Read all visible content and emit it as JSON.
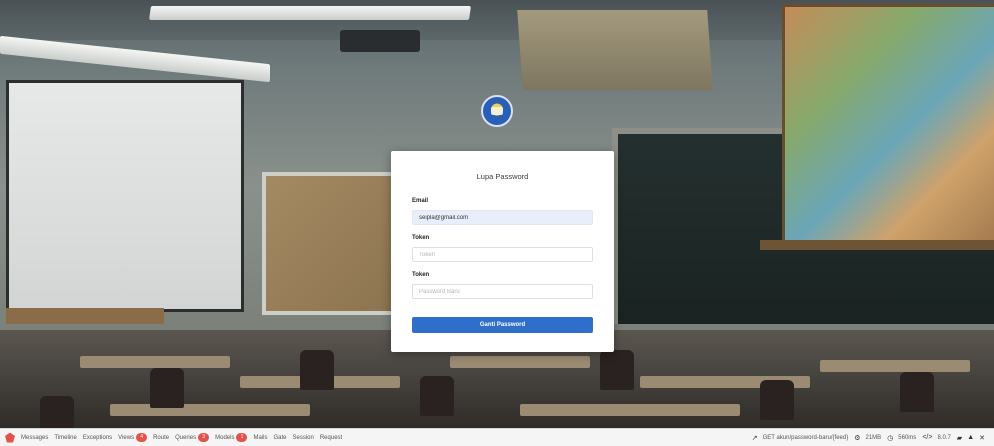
{
  "card": {
    "title": "Lupa Password",
    "email_label": "Email",
    "email_value": "seipla@gmail.com",
    "token_label": "Token",
    "token_placeholder": "Token",
    "password_label": "Token",
    "password_placeholder": "Password Baru",
    "submit_label": "Ganti Password"
  },
  "debugbar": {
    "tabs": [
      {
        "label": "Messages"
      },
      {
        "label": "Timeline"
      },
      {
        "label": "Exceptions"
      },
      {
        "label": "Views",
        "badge": "4"
      },
      {
        "label": "Route"
      },
      {
        "label": "Queries",
        "badge": "3"
      },
      {
        "label": "Models",
        "badge": "1"
      },
      {
        "label": "Mails"
      },
      {
        "label": "Gate"
      },
      {
        "label": "Session"
      },
      {
        "label": "Request"
      }
    ],
    "route": "GET akun/password-baru/{feed}",
    "memory": "21MB",
    "time": "560ms",
    "version": "8.0.7"
  },
  "colors": {
    "primary": "#2f6fcb",
    "badge": "#e3534a"
  }
}
